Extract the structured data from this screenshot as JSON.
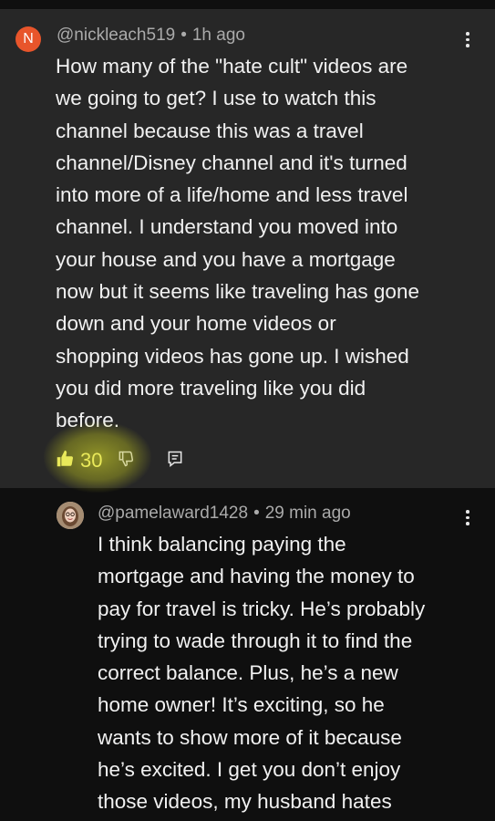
{
  "comment": {
    "avatar_letter": "N",
    "author": "@nickleach519",
    "time": "1h ago",
    "text": "How many of the \"hate cult\" videos are\nwe going to get?  I use to watch this\nchannel because this was a travel\nchannel/Disney channel and it's turned\ninto more of a life/home and less travel\nchannel.  I understand you moved into\nyour house and you have a mortgage\nnow but it seems like traveling has gone\ndown and your home videos or\nshopping videos has gone up.  I wished\nyou did more traveling like you did\nbefore.",
    "likes": "30",
    "colors": {
      "avatar_bg": "#e8552b",
      "highlight": "#e6eb28"
    }
  },
  "reply": {
    "author": "@pamelaward1428",
    "time": "29 min ago",
    "text": "I think balancing paying the\nmortgage and having the money to\npay for travel is tricky. He’s probably\ntrying to wade through it to find the\ncorrect balance. Plus, he’s a new\nhome owner! It’s exciting, so he\nwants to show more of it because\nhe’s excited. I get you don’t enjoy\nthose videos, my husband hates"
  },
  "icons": [
    "kebab-menu-icon",
    "thumbs-up-icon",
    "thumbs-down-icon",
    "reply-icon"
  ],
  "separator": "•"
}
